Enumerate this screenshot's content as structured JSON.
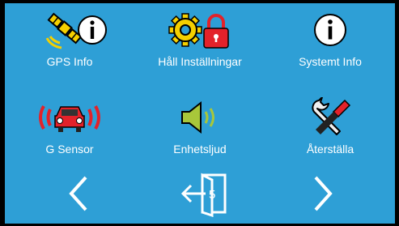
{
  "menu": {
    "items": [
      {
        "label": "GPS Info",
        "icon": "gps-satellite-info-icon"
      },
      {
        "label": "Håll Inställningar",
        "icon": "gear-lock-icon"
      },
      {
        "label": "Systemt Info",
        "icon": "info-icon"
      },
      {
        "label": "G Sensor",
        "icon": "car-sensor-icon"
      },
      {
        "label": "Enhetsljud",
        "icon": "speaker-icon"
      },
      {
        "label": "Återställa",
        "icon": "tools-reset-icon"
      }
    ]
  },
  "footer": {
    "page_number": "5",
    "prev_icon": "chevron-left-icon",
    "next_icon": "chevron-right-icon",
    "exit_icon": "exit-door-icon"
  },
  "colors": {
    "background": "#2e9fd6",
    "frame": "#000000",
    "gear": "#f5d000",
    "lock": "#e3222a",
    "car": "#e3222a",
    "speaker": "#a8c73a"
  }
}
